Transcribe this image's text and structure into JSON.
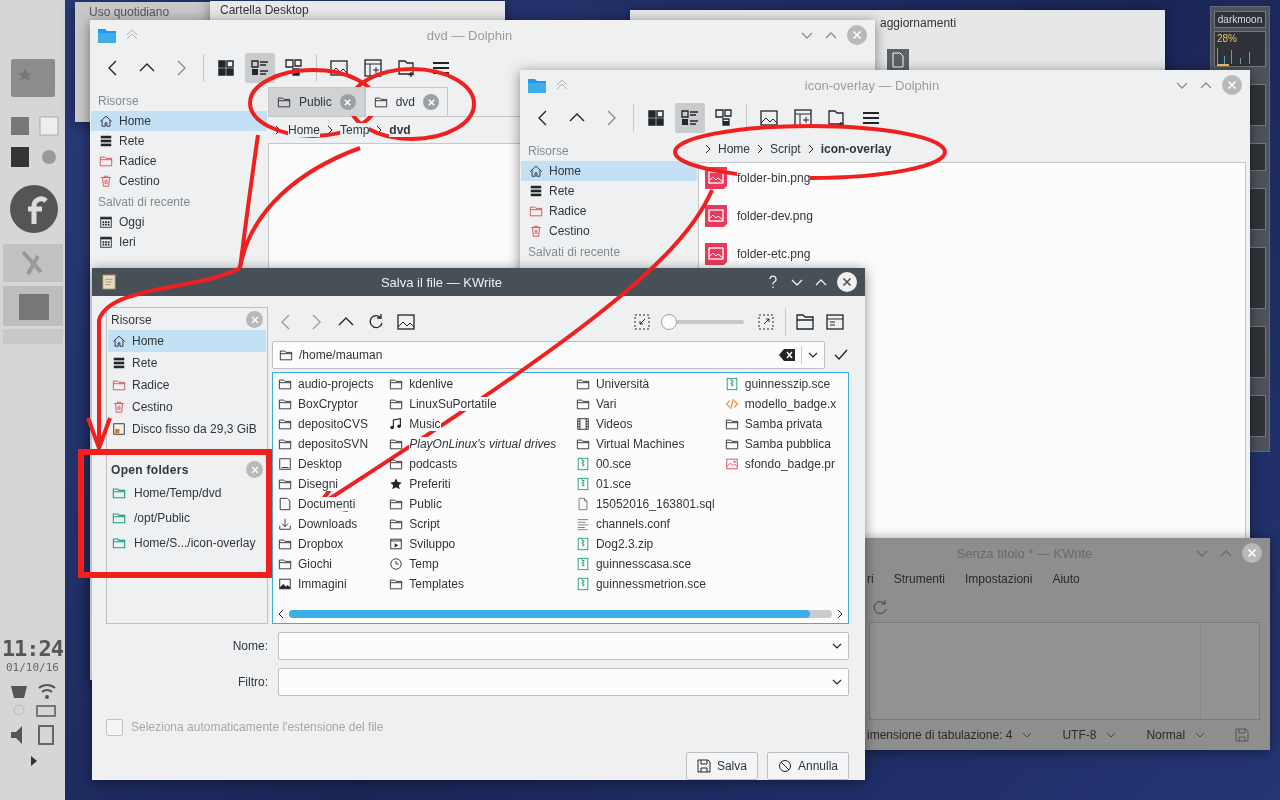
{
  "desktop": {
    "left_panel": {
      "clock": "11:24",
      "date": "01/10/16"
    },
    "right_panel": {
      "host": "darkmoon",
      "cpu_reading": "28%"
    },
    "background_windows": [
      {
        "title": "Uso quotidiano"
      },
      {
        "title": "Cartella Desktop"
      },
      {
        "title": "aggiornamenti"
      }
    ]
  },
  "dolphin_windows": [
    {
      "title": "dvd — Dolphin",
      "view_modes": [
        {
          "kind": "icons",
          "selected": false
        },
        {
          "kind": "details",
          "selected": true
        },
        {
          "kind": "tree",
          "selected": false
        }
      ],
      "sidebar": [
        {
          "heading": "Risorse",
          "items": [
            {
              "label": "Home",
              "kind": "home",
              "selected": true
            },
            {
              "label": "Rete",
              "kind": "network",
              "selected": false
            },
            {
              "label": "Radice",
              "kind": "root",
              "selected": false
            },
            {
              "label": "Cestino",
              "kind": "trash",
              "selected": false
            }
          ]
        },
        {
          "heading": "Salvati di recente",
          "items": [
            {
              "label": "Oggi",
              "kind": "calendar",
              "selected": false
            },
            {
              "label": "Ieri",
              "kind": "calendar",
              "selected": false
            }
          ]
        }
      ],
      "tabs": [
        {
          "label": "Public",
          "selected": false
        },
        {
          "label": "dvd",
          "selected": true
        }
      ],
      "breadcrumb": [
        "Home",
        "Temp",
        "dvd"
      ]
    },
    {
      "title": "icon-overlay — Dolphin",
      "view_modes": [
        {
          "kind": "icons",
          "selected": false
        },
        {
          "kind": "details",
          "selected": true
        },
        {
          "kind": "tree",
          "selected": false
        }
      ],
      "sidebar": [
        {
          "heading": "Risorse",
          "items": [
            {
              "label": "Home",
              "kind": "home",
              "selected": true
            },
            {
              "label": "Rete",
              "kind": "network",
              "selected": false
            },
            {
              "label": "Radice",
              "kind": "root",
              "selected": false
            },
            {
              "label": "Cestino",
              "kind": "trash",
              "selected": false
            }
          ]
        },
        {
          "heading": "Salvati di recente"
        }
      ],
      "breadcrumb": [
        "Home",
        "Script",
        "icon-overlay"
      ],
      "files": [
        "folder-bin.png",
        "folder-dev.png",
        "folder-etc.png"
      ]
    }
  ],
  "editor_window": {
    "title": "Senza titolo * — KWrite",
    "menu": [
      "ri",
      "Strumenti",
      "Impostazioni",
      "Aiuto"
    ],
    "status": {
      "tab_width": "imensione di tabulazione: 4",
      "encoding": "UTF-8",
      "mode": "Normal"
    }
  },
  "save_dialog": {
    "title": "Salva il file — KWrite",
    "places": {
      "heading": "Risorse",
      "items": [
        {
          "label": "Home",
          "kind": "home",
          "selected": true
        },
        {
          "label": "Rete",
          "kind": "network",
          "selected": false
        },
        {
          "label": "Radice",
          "kind": "root",
          "selected": false
        },
        {
          "label": "Cestino",
          "kind": "trash",
          "selected": false
        },
        {
          "label": "Disco fisso da 29,3 GiB",
          "kind": "disk",
          "selected": false
        }
      ]
    },
    "open_folders": {
      "heading": "Open folders",
      "items": [
        {
          "label": "Home/Temp/dvd",
          "selected": false
        },
        {
          "label": "/opt/Public",
          "selected": false
        },
        {
          "label": "Home/S.../icon-overlay",
          "selected": false
        }
      ]
    },
    "zoom": {
      "level": 0.05
    },
    "path": "/home/mauman",
    "file_columns": [
      [
        {
          "name": "audio-projects",
          "kind": "folder"
        },
        {
          "name": "BoxCryptor",
          "kind": "folder"
        },
        {
          "name": "depositoCVS",
          "kind": "folder"
        },
        {
          "name": "depositoSVN",
          "kind": "folder"
        },
        {
          "name": "Desktop",
          "kind": "desktop"
        },
        {
          "name": "Disegni",
          "kind": "folder"
        },
        {
          "name": "Documenti",
          "kind": "document"
        },
        {
          "name": "Downloads",
          "kind": "download"
        },
        {
          "name": "Dropbox",
          "kind": "folder"
        },
        {
          "name": "Giochi",
          "kind": "folder"
        },
        {
          "name": "Immagini",
          "kind": "pictures"
        }
      ],
      [
        {
          "name": "kdenlive",
          "kind": "folder"
        },
        {
          "name": "LinuxSuPortatile",
          "kind": "folder"
        },
        {
          "name": "Music",
          "kind": "music"
        },
        {
          "name": "PlayOnLinux's virtual drives",
          "kind": "symlink"
        },
        {
          "name": "podcasts",
          "kind": "folder"
        },
        {
          "name": "Preferiti",
          "kind": "star"
        },
        {
          "name": "Public",
          "kind": "folder"
        },
        {
          "name": "Script",
          "kind": "folder"
        },
        {
          "name": "Sviluppo",
          "kind": "play"
        },
        {
          "name": "Temp",
          "kind": "clock"
        },
        {
          "name": "Templates",
          "kind": "folder"
        }
      ],
      [
        {
          "name": "Università",
          "kind": "folder"
        },
        {
          "name": "Vari",
          "kind": "folder"
        },
        {
          "name": "Videos",
          "kind": "video"
        },
        {
          "name": "Virtual Machines",
          "kind": "folder"
        },
        {
          "name": "00.sce",
          "kind": "archive"
        },
        {
          "name": "01.sce",
          "kind": "archive"
        },
        {
          "name": "15052016_163801.sql",
          "kind": "file"
        },
        {
          "name": "channels.conf",
          "kind": "text"
        },
        {
          "name": "Dog2.3.zip",
          "kind": "archive"
        },
        {
          "name": "guinnesscasa.sce",
          "kind": "archive"
        },
        {
          "name": "guinnessmetrion.sce",
          "kind": "archive"
        }
      ],
      [
        {
          "name": "guinnesszip.sce",
          "kind": "archive"
        },
        {
          "name": "modello_badge.x",
          "kind": "code"
        },
        {
          "name": "Samba privata",
          "kind": "folder"
        },
        {
          "name": "Samba pubblica",
          "kind": "folder"
        },
        {
          "name": "sfondo_badge.pr",
          "kind": "image"
        }
      ]
    ],
    "name_label": "Nome:",
    "filter_label": "Filtro:",
    "auto_extension": {
      "label": "Seleziona automaticamente l'estensione del file",
      "checked": false,
      "disabled": true
    },
    "buttons": [
      {
        "label": "Salva",
        "kind": "save"
      },
      {
        "label": "Annulla",
        "kind": "cancel"
      }
    ]
  }
}
